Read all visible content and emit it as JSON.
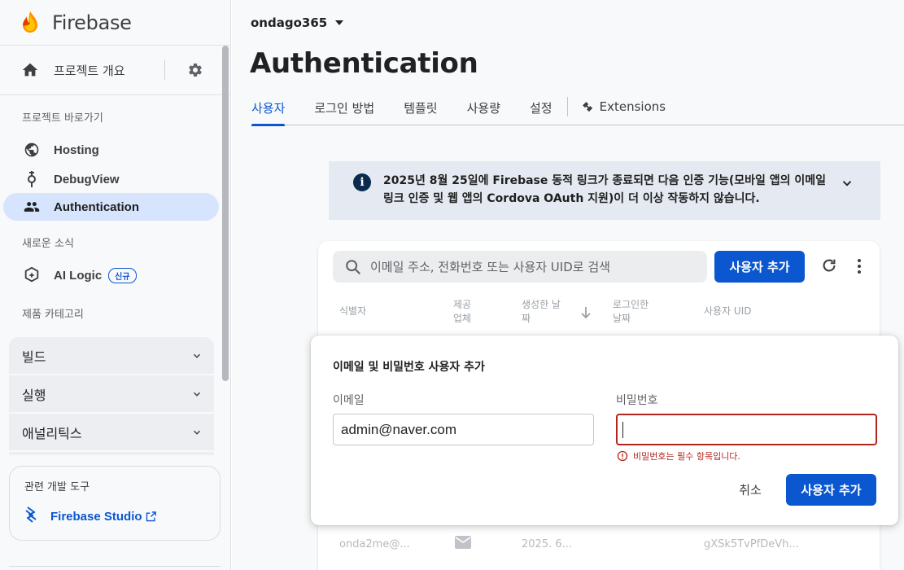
{
  "brand": {
    "name": "Firebase",
    "logo_icon": "firebase-flame-icon"
  },
  "sidebar": {
    "overview_label": "프로젝트 개요",
    "shortcuts_header": "프로젝트 바로가기",
    "shortcuts": [
      {
        "label": "Hosting",
        "icon": "globe-icon"
      },
      {
        "label": "DebugView",
        "icon": "debug-icon"
      },
      {
        "label": "Authentication",
        "icon": "people-icon",
        "active": true
      }
    ],
    "news_header": "새로운 소식",
    "ai_logic": {
      "label": "AI Logic",
      "badge": "신규"
    },
    "categories_header": "제품 카테고리",
    "categories": [
      "빌드",
      "실행",
      "애널리틱스"
    ],
    "devtools": {
      "title": "관련 개발 도구",
      "link_label": "Firebase Studio"
    }
  },
  "header": {
    "project_name": "ondago365",
    "page_title": "Authentication",
    "tabs": [
      "사용자",
      "로그인 방법",
      "템플릿",
      "사용량",
      "설정"
    ],
    "extensions_label": "Extensions"
  },
  "banner": {
    "text": "2025년 8월 25일에 Firebase 동적 링크가 종료되면 다음 인증 기능(모바일 앱의 이메일 링크 인증 및 웹 앱의 Cordova OAuth 지원)이 더 이상 작동하지 않습니다."
  },
  "users_table": {
    "search_placeholder": "이메일 주소, 전화번호 또는 사용자 UID로 검색",
    "add_user_label": "사용자 추가",
    "columns": [
      "식별자",
      "제공\n업체",
      "생성한 날\n짜",
      "로그인한\n날짜",
      "사용자 UID"
    ],
    "rows": [
      {
        "identifier": "onda2me@...",
        "created": "2025. 6...",
        "uid": "gXSk5TvPfDeVh..."
      }
    ]
  },
  "dialog": {
    "title": "이메일 및 비밀번호 사용자 추가",
    "email_label": "이메일",
    "email_value": "admin@naver.com",
    "password_label": "비밀번호",
    "password_value": "",
    "error_text": "비밀번호는 필수 항목입니다.",
    "cancel_label": "취소",
    "submit_label": "사용자 추가"
  },
  "colors": {
    "accent": "#0b57d0",
    "error": "#b3261e",
    "active_nav": "#d6e4fd"
  }
}
